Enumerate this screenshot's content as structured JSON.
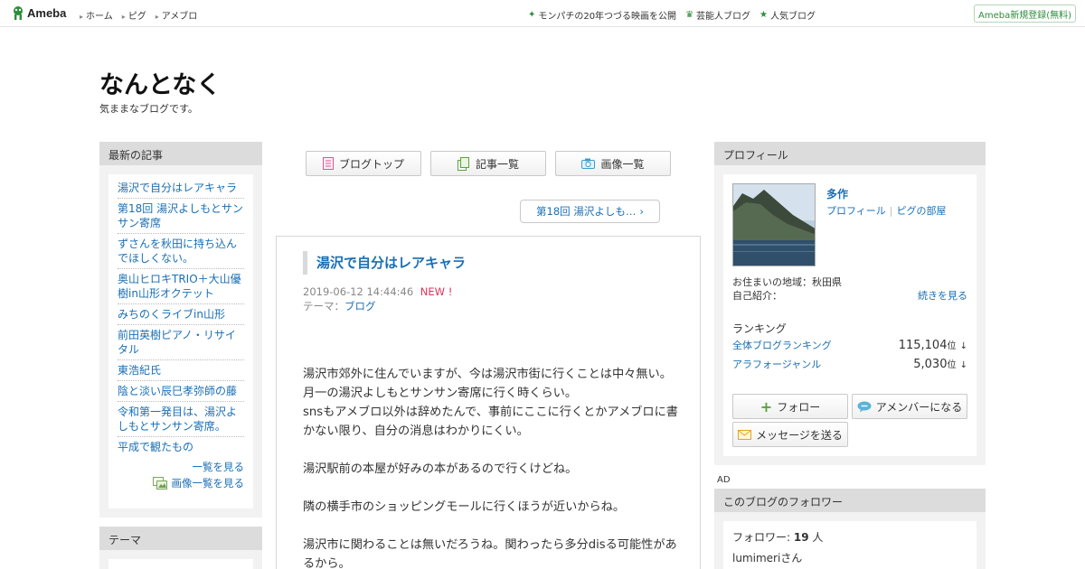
{
  "topbar": {
    "logo": "Ameba",
    "nav": [
      "ホーム",
      "ピグ",
      "アメブロ"
    ],
    "right": [
      {
        "label": "モンパチの20年つづる映画を公開",
        "icon": "sparkle-icon"
      },
      {
        "label": "芸能人ブログ",
        "icon": "crown-icon"
      },
      {
        "label": "人気ブログ",
        "icon": "star-icon"
      }
    ],
    "register": "Ameba新規登録(無料)"
  },
  "blog": {
    "title": "なんとなく",
    "subtitle": "気ままなブログです。"
  },
  "sidebar_left": {
    "recent_heading": "最新の記事",
    "recent": [
      "湯沢で自分はレアキャラ",
      "第18回 湯沢よしもとサンサン寄席",
      "ずさんを秋田に持ち込んでほしくない。",
      "奥山ヒロキTRIO＋大山優樹in山形オクテット",
      "みちのくライブin山形",
      "前田英樹ピアノ・リサイタル",
      "東浩紀氏",
      "陰と淡い辰巳孝弥師の藤",
      "令和第一発目は、湯沢よしもとサンサン寄席。",
      "平成で観たもの"
    ],
    "more": "一覧を見る",
    "more_images": "画像一覧を見る",
    "theme_heading": "テーマ"
  },
  "center": {
    "nav_buttons": [
      {
        "label": "ブログトップ",
        "icon": "document-icon"
      },
      {
        "label": "記事一覧",
        "icon": "list-icon"
      },
      {
        "label": "画像一覧",
        "icon": "camera-icon"
      }
    ],
    "next_article": "第18回 湯沢よしも…",
    "article": {
      "title": "湯沢で自分はレアキャラ",
      "date": "2019-06-12 14:44:46",
      "new_badge": "NEW !",
      "theme_label": "テーマ：",
      "theme": "ブログ",
      "paragraphs": [
        "湯沢市郊外に住んでいますが、今は湯沢市街に行くことは中々無い。月一の湯沢よしもとサンサン寄席に行く時くらい。\nsnsもアメブロ以外は辞めたんで、事前にここに行くとかアメブロに書かない限り、自分の消息はわかりにくい。",
        "湯沢駅前の本屋が好みの本があるので行くけどね。",
        "隣の横手市のショッピングモールに行くほうが近いからね。",
        "湯沢市に関わることは無いだろうね。関わったら多分disる可能性があるから。"
      ]
    }
  },
  "sidebar_right": {
    "profile_heading": "プロフィール",
    "name": "多作",
    "profile_link": "プロフィール",
    "pig_link": "ピグの部屋",
    "location": "お住まいの地域：秋田県",
    "intro": "自己紹介：",
    "read_more": "続きを見る",
    "ranking_title": "ランキング",
    "rankings": [
      {
        "label": "全体ブログランキング",
        "value": "115,104",
        "unit": "位",
        "arrow": "↓"
      },
      {
        "label": "アラフォージャンル",
        "value": "5,030",
        "unit": "位",
        "arrow": "↓"
      }
    ],
    "buttons": [
      {
        "label": "フォロー",
        "icon": "plus-icon"
      },
      {
        "label": "アメンバーになる",
        "icon": "chat-icon"
      },
      {
        "label": "メッセージを送る",
        "icon": "mail-icon"
      }
    ],
    "ad": "AD",
    "followers_heading": "このブログのフォロワー",
    "followers_label": "フォロワー:",
    "followers_count": "19",
    "followers_unit": "人",
    "follower_name": "lumimeriさん"
  },
  "colors": {
    "link": "#1a6fb5",
    "new_badge": "#e0335b",
    "ameba_green": "#2d8c3c",
    "panel_header": "#dcdcdc",
    "panel_bg": "#f2f2f2"
  }
}
